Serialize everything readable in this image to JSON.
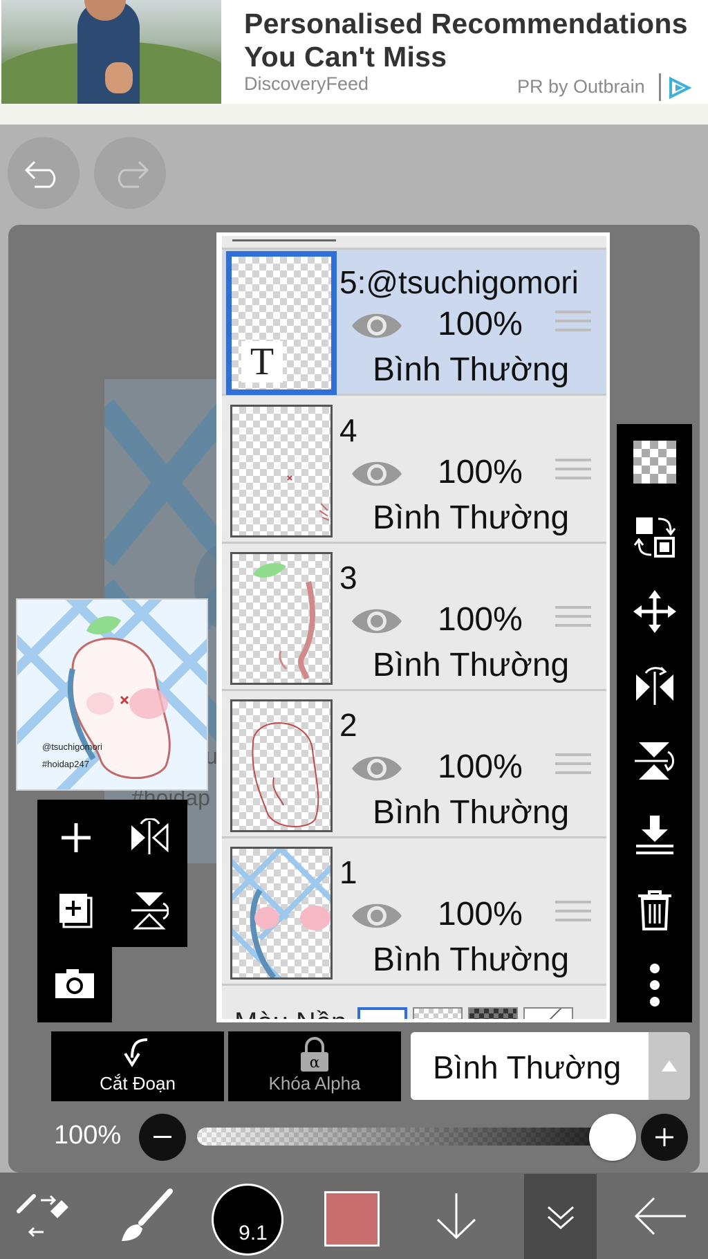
{
  "ad": {
    "title": "Personalised Recommendations You Can't Miss",
    "source": "DiscoveryFeed",
    "sponsor": "PR by Outbrain"
  },
  "history": {
    "undo_icon": "undo-icon",
    "redo_icon": "redo-icon"
  },
  "canvas": {
    "text_fragment_1": "ui",
    "text_fragment_2": "#hoidap"
  },
  "preview": {
    "handle": "@tsuchigomori",
    "tag": "#hoidap247"
  },
  "layers": [
    {
      "name": "5:@tsuchigomori",
      "opacity": "100%",
      "blend": "Bình Thường",
      "selected": true,
      "thumb_letter": "T"
    },
    {
      "name": "4",
      "opacity": "100%",
      "blend": "Bình Thường",
      "selected": false
    },
    {
      "name": "3",
      "opacity": "100%",
      "blend": "Bình Thường",
      "selected": false
    },
    {
      "name": "2",
      "opacity": "100%",
      "blend": "Bình Thường",
      "selected": false
    },
    {
      "name": "1",
      "opacity": "100%",
      "blend": "Bình Thường",
      "selected": false
    }
  ],
  "background": {
    "label": "Màu Nền"
  },
  "controls": {
    "clip_label": "Cắt Đoạn",
    "alpha_lock_label": "Khóa Alpha",
    "blend_mode": "Bình Thường",
    "opacity_label": "100%",
    "opacity_value": 1.0
  },
  "brush": {
    "size": "9.1"
  },
  "colors": {
    "accent": "#2f6fd8",
    "selected_row": "#cbd8ee",
    "current_color": "#c96e6e"
  }
}
